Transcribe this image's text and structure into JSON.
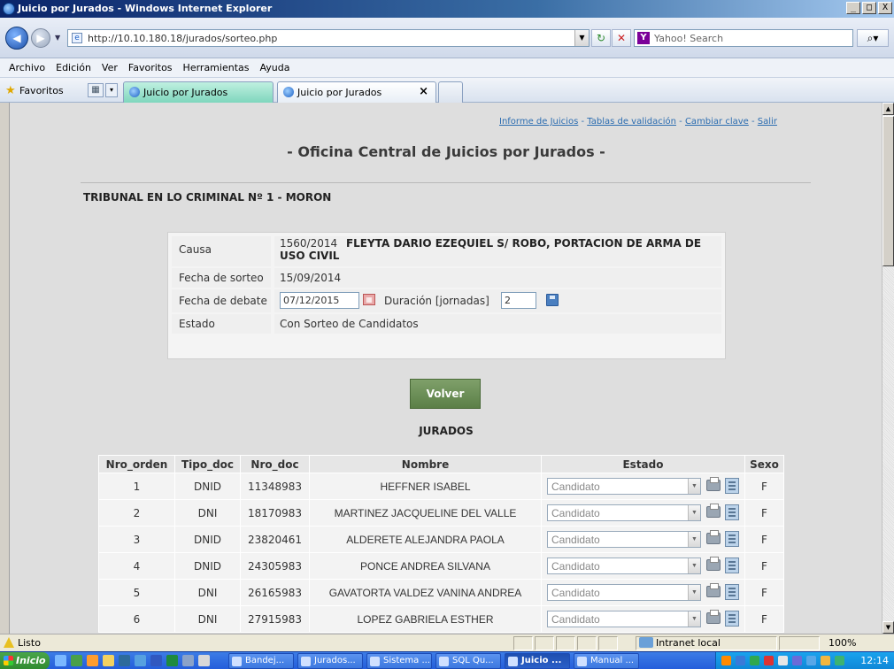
{
  "window": {
    "title": "Juicio por Jurados - Windows Internet Explorer",
    "buttons": {
      "minimize": "_",
      "maximize": "□",
      "close": "X"
    }
  },
  "browser": {
    "url": "http://10.10.180.18/jurados/sorteo.php",
    "search_placeholder": "Yahoo! Search",
    "menu": [
      "Archivo",
      "Edición",
      "Ver",
      "Favoritos",
      "Herramientas",
      "Ayuda"
    ],
    "favorites_label": "Favoritos",
    "tabs": [
      {
        "label": "Juicio por Jurados"
      },
      {
        "label": "Juicio por Jurados"
      }
    ]
  },
  "page": {
    "top_links": [
      "Informe de Juicios",
      "Tablas de validación",
      "Cambiar clave",
      "Salir"
    ],
    "top_links_sep": " - ",
    "title": "- Oficina Central de Juicios por Jurados -",
    "tribunal": "TRIBUNAL EN LO CRIMINAL Nº 1 - MORON",
    "causa": {
      "label": "Causa",
      "number": "1560/2014",
      "description": "FLEYTA DARIO EZEQUIEL S/ ROBO, PORTACION DE ARMA DE USO CIVIL",
      "fecha_sorteo_label": "Fecha de sorteo",
      "fecha_sorteo": "15/09/2014",
      "fecha_debate_label": "Fecha de debate",
      "fecha_debate": "07/12/2015",
      "duracion_label": "Duración [jornadas]",
      "duracion": "2",
      "estado_label": "Estado",
      "estado": "Con Sorteo de Candidatos"
    },
    "volver_label": "Volver",
    "jurados_title": "JURADOS",
    "table": {
      "headers": [
        "Nro_orden",
        "Tipo_doc",
        "Nro_doc",
        "Nombre",
        "Estado",
        "Sexo"
      ],
      "rows": [
        {
          "orden": "1",
          "tipo": "DNID",
          "doc": "11348983",
          "nombre": "HEFFNER ISABEL",
          "estado": "Candidato",
          "sexo": "F"
        },
        {
          "orden": "2",
          "tipo": "DNI",
          "doc": "18170983",
          "nombre": "MARTINEZ JACQUELINE DEL VALLE",
          "estado": "Candidato",
          "sexo": "F"
        },
        {
          "orden": "3",
          "tipo": "DNID",
          "doc": "23820461",
          "nombre": "ALDERETE ALEJANDRA PAOLA",
          "estado": "Candidato",
          "sexo": "F"
        },
        {
          "orden": "4",
          "tipo": "DNID",
          "doc": "24305983",
          "nombre": "PONCE ANDREA SILVANA",
          "estado": "Candidato",
          "sexo": "F"
        },
        {
          "orden": "5",
          "tipo": "DNI",
          "doc": "26165983",
          "nombre": "GAVATORTA VALDEZ VANINA ANDREA",
          "estado": "Candidato",
          "sexo": "F"
        },
        {
          "orden": "6",
          "tipo": "DNI",
          "doc": "27915983",
          "nombre": "LOPEZ GABRIELA ESTHER",
          "estado": "Candidato",
          "sexo": "F"
        }
      ]
    }
  },
  "statusbar": {
    "text": "Listo",
    "zone": "Intranet local",
    "zoom": "100%"
  },
  "taskbar": {
    "start": "Inicio",
    "tasks": [
      "Bandej...",
      "Jurados...",
      "Sistema ...",
      "SQL Qu...",
      "Juicio ...",
      "Manual ..."
    ],
    "clock": "12:14"
  }
}
